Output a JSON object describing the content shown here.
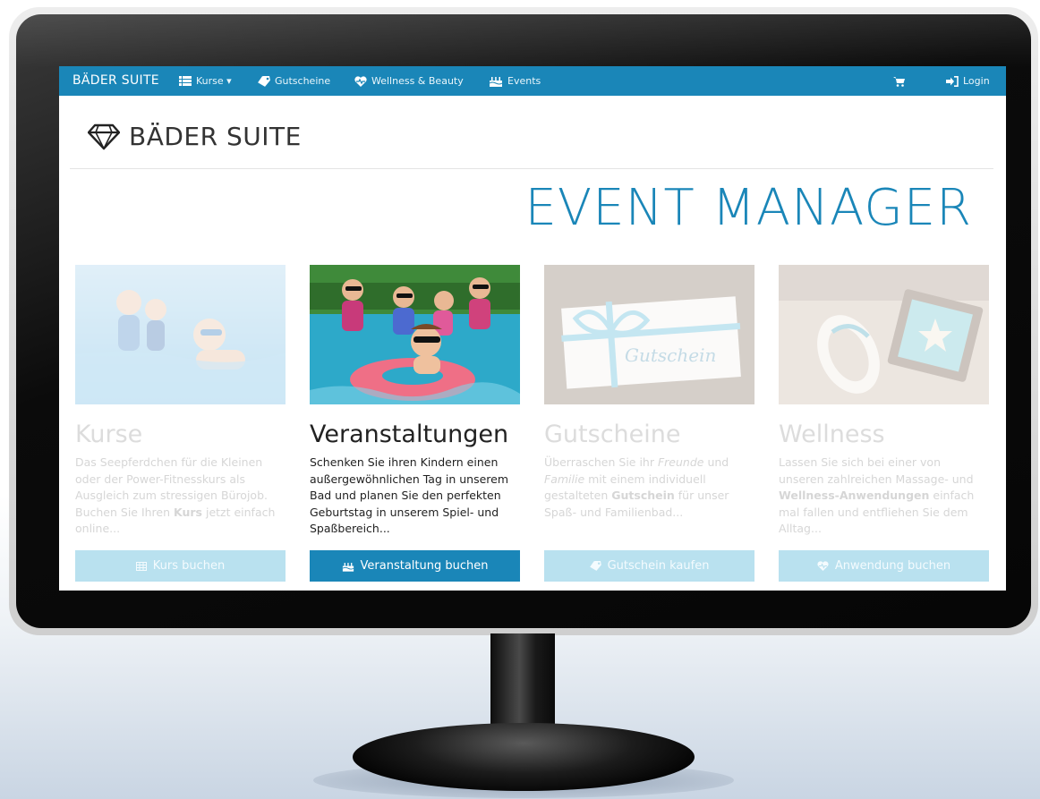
{
  "navbar": {
    "brand": "BÄDER SUITE",
    "items": [
      {
        "label": "Kurse ▾",
        "icon": "list-icon"
      },
      {
        "label": "Gutscheine",
        "icon": "tag-icon"
      },
      {
        "label": "Wellness & Beauty",
        "icon": "heartbeat-icon"
      },
      {
        "label": "Events",
        "icon": "birthday-cake-icon"
      }
    ],
    "cart_icon": "cart-icon",
    "login_label": "Login"
  },
  "header": {
    "logo_text": "BÄDER SUITE",
    "logo_icon": "diamond-icon"
  },
  "hero": {
    "title": "EVENT MANAGER"
  },
  "cards": [
    {
      "title": "Kurse",
      "desc_parts": [
        "Das Seepferdchen für die Kleinen oder der Power-Fitnesskurs als Ausgleich zum stressigen Bürojob. Buchen Sie Ihren ",
        "Kurs",
        " jetzt einfach online..."
      ],
      "button": "Kurs buchen",
      "button_icon": "table-icon",
      "state": "faded"
    },
    {
      "title": "Veranstaltungen",
      "desc": "Schenken Sie ihren Kindern einen außergewöhnlichen Tag in unserem Bad und planen Sie den perfekten Geburtstag in unserem Spiel- und Spaßbereich...",
      "button": "Veranstaltung buchen",
      "button_icon": "birthday-cake-icon",
      "state": "active"
    },
    {
      "title": "Gutscheine",
      "desc_parts": [
        "Überraschen Sie ihr ",
        "Freunde",
        " und ",
        "Familie",
        " mit einem individuell gestalteten ",
        "Gutschein",
        " für unser Spaß- und Familienbad..."
      ],
      "button": "Gutschein kaufen",
      "button_icon": "tag-icon",
      "image_text": "Gutschein",
      "state": "faded"
    },
    {
      "title": "Wellness",
      "desc_parts": [
        "Lassen Sie sich bei einer von unseren zahlreichen Massage- und ",
        "Wellness-Anwendungen",
        " einfach mal fallen und entfliehen Sie dem Alltag..."
      ],
      "button": "Anwendung buchen",
      "button_icon": "heartbeat-icon",
      "state": "faded"
    }
  ],
  "colors": {
    "primary": "#1a86b8",
    "faded_button": "#b9e1ef",
    "bezel": "#0b0b0b"
  }
}
